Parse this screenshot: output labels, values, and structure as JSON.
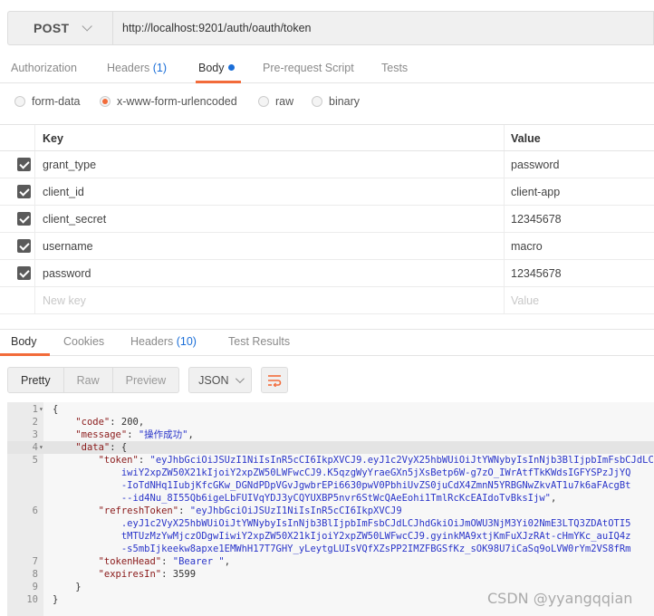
{
  "request": {
    "method": "POST",
    "url": "http://localhost:9201/auth/oauth/token"
  },
  "request_tabs": [
    {
      "label": "Authorization"
    },
    {
      "label": "Headers",
      "count": "(1)"
    },
    {
      "label": "Body"
    },
    {
      "label": "Pre-request Script"
    },
    {
      "label": "Tests"
    }
  ],
  "body_types": [
    {
      "label": "form-data",
      "selected": false
    },
    {
      "label": "x-www-form-urlencoded",
      "selected": true
    },
    {
      "label": "raw",
      "selected": false
    },
    {
      "label": "binary",
      "selected": false
    }
  ],
  "params": {
    "key_header": "Key",
    "value_header": "Value",
    "rows": [
      {
        "key": "grant_type",
        "value": "password"
      },
      {
        "key": "client_id",
        "value": "client-app"
      },
      {
        "key": "client_secret",
        "value": "12345678"
      },
      {
        "key": "username",
        "value": "macro"
      },
      {
        "key": "password",
        "value": "12345678"
      }
    ],
    "new_key_placeholder": "New key",
    "new_value_placeholder": "Value"
  },
  "response_tabs": [
    {
      "label": "Body"
    },
    {
      "label": "Cookies"
    },
    {
      "label": "Headers",
      "count": "(10)"
    },
    {
      "label": "Test Results"
    }
  ],
  "view_modes": [
    "Pretty",
    "Raw",
    "Preview"
  ],
  "format": "JSON",
  "code_lines": [
    {
      "n": "1",
      "fold": "▾",
      "parts": [
        [
          "punct",
          "{"
        ]
      ]
    },
    {
      "n": "2",
      "fold": "",
      "parts": [
        [
          "punct",
          "    "
        ],
        [
          "key",
          "\"code\""
        ],
        [
          "punct",
          ": "
        ],
        [
          "num",
          "200"
        ],
        [
          "punct",
          ","
        ]
      ]
    },
    {
      "n": "3",
      "fold": "",
      "parts": [
        [
          "punct",
          "    "
        ],
        [
          "key",
          "\"message\""
        ],
        [
          "punct",
          ": "
        ],
        [
          "str",
          "\"操作成功\""
        ],
        [
          "punct",
          ","
        ]
      ]
    },
    {
      "n": "4",
      "fold": "▾",
      "parts": [
        [
          "punct",
          "    "
        ],
        [
          "key",
          "\"data\""
        ],
        [
          "punct",
          ": {"
        ]
      ]
    },
    {
      "n": "5",
      "fold": "",
      "parts": [
        [
          "punct",
          "        "
        ],
        [
          "key",
          "\"token\""
        ],
        [
          "punct",
          ": "
        ],
        [
          "str",
          "\"eyJhbGciOiJSUzI1NiIsInR5cCI6IkpXVCJ9.eyJ1c2VyX25hbWUiOiJtYWNybyIsInNjb3BlIjpbImFsbCJdLC"
        ]
      ]
    },
    {
      "n": "",
      "fold": "",
      "parts": [
        [
          "str",
          "            iwiY2xpZW50X21kIjoiY2xpZW50LWFwcCJ9.K5qzgWyYraeGXn5jXsBetp6W-g7zO_IWrAtfTkKWdsIGFYSPzJjYQ"
        ]
      ]
    },
    {
      "n": "",
      "fold": "",
      "parts": [
        [
          "str",
          "            -IoTdNHq1IubjKfcGKw_DGNdPDpVGvJgwbrEPi6630pwV0PbhiUvZS0juCdX4ZmnN5YRBGNwZkvAT1u7k6aFAcgBt"
        ]
      ]
    },
    {
      "n": "",
      "fold": "",
      "parts": [
        [
          "str",
          "            --id4Nu_8I55Qb6igeLbFUIVqYDJ3yCQYUXBP5nvr6StWcQAeEohi1TmlRcKcEAIdoTvBksIjw\""
        ],
        [
          "punct",
          ","
        ]
      ]
    },
    {
      "n": "6",
      "fold": "",
      "parts": [
        [
          "punct",
          "        "
        ],
        [
          "key",
          "\"refreshToken\""
        ],
        [
          "punct",
          ": "
        ],
        [
          "str",
          "\"eyJhbGciOiJSUzI1NiIsInR5cCI6IkpXVCJ9"
        ]
      ]
    },
    {
      "n": "",
      "fold": "",
      "parts": [
        [
          "str",
          "            .eyJ1c2VyX25hbWUiOiJtYWNybyIsInNjb3BlIjpbImFsbCJdLCJhdGkiOiJmOWU3NjM3Yi02NmE3LTQ3ZDAtOTI5"
        ]
      ]
    },
    {
      "n": "",
      "fold": "",
      "parts": [
        [
          "str",
          "            tMTUzMzYwMjczODgwIiwiY2xpZW50X21kIjoiY2xpZW50LWFwcCJ9.gyinkMA9xtjKmFuXJzRAt-cHmYKc_auIQ4z"
        ]
      ]
    },
    {
      "n": "",
      "fold": "",
      "parts": [
        [
          "str",
          "            -s5mbIjkeekw8apxe1EMWhH17T7GHY_yLeytgLUIsVQfXZsPP2IMZFBGSfKz_sOK98U7iCaSq9oLVW0rYm2VS8fRm"
        ]
      ]
    },
    {
      "n": "7",
      "fold": "",
      "parts": [
        [
          "punct",
          "        "
        ],
        [
          "key",
          "\"tokenHead\""
        ],
        [
          "punct",
          ": "
        ],
        [
          "str",
          "\"Bearer \""
        ],
        [
          "punct",
          ","
        ]
      ]
    },
    {
      "n": "8",
      "fold": "",
      "parts": [
        [
          "punct",
          "        "
        ],
        [
          "key",
          "\"expiresIn\""
        ],
        [
          "punct",
          ": "
        ],
        [
          "num",
          "3599"
        ]
      ]
    },
    {
      "n": "9",
      "fold": "",
      "parts": [
        [
          "punct",
          "    }"
        ]
      ]
    },
    {
      "n": "10",
      "fold": "",
      "parts": [
        [
          "punct",
          "}"
        ]
      ]
    }
  ],
  "watermark": "CSDN @yyangqqian",
  "colors": {
    "accent": "#f26b3a",
    "link": "#1a6ed8"
  }
}
